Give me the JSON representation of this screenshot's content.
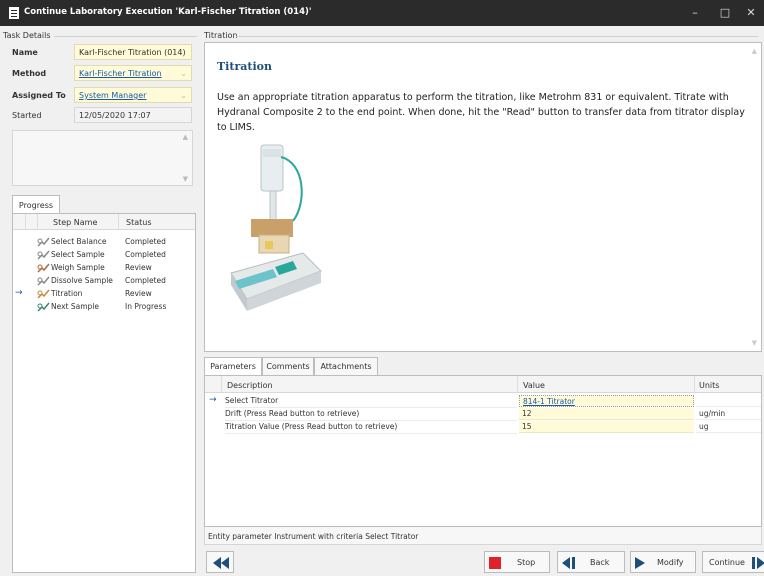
{
  "window": {
    "title": "Continue Laboratory Execution 'Karl-Fischer Titration (014)'"
  },
  "task_details": {
    "group_title": "Task Details",
    "name_label": "Name",
    "name_value": "Karl-Fischer Titration (014)",
    "method_label": "Method",
    "method_value": "Karl-Fischer Titration",
    "assigned_label": "Assigned To",
    "assigned_value": "System Manager",
    "started_label": "Started",
    "started_value": "12/05/2020 17:07"
  },
  "progress": {
    "tab": "Progress",
    "col_step": "Step Name",
    "col_status": "Status",
    "rows": [
      {
        "step": "Select Balance",
        "status": "Completed",
        "current": false,
        "icon": "done-steps-icon"
      },
      {
        "step": "Select Sample",
        "status": "Completed",
        "current": false,
        "icon": "done-steps-icon"
      },
      {
        "step": "Weigh Sample",
        "status": "Review",
        "current": false,
        "icon": "review-steps-icon"
      },
      {
        "step": "Dissolve Sample",
        "status": "Completed",
        "current": false,
        "icon": "done-steps-icon"
      },
      {
        "step": "Titration",
        "status": "Review",
        "current": true,
        "icon": "active-steps-icon"
      },
      {
        "step": "Next Sample",
        "status": "In Progress",
        "current": false,
        "icon": "progress-steps-icon"
      }
    ]
  },
  "titration": {
    "group_title": "Titration",
    "heading": "Titration",
    "instructions": "Use an appropriate titration apparatus to perform the titration, like Metrohm 831 or equivalent. Titrate with Hydranal Composite 2 to the end point. When done, hit the \"Read\" button to transfer data from titrator display to LIMS."
  },
  "params": {
    "tabs": [
      "Parameters",
      "Comments",
      "Attachments"
    ],
    "col_description": "Description",
    "col_value": "Value",
    "col_units": "Units",
    "rows": [
      {
        "description": "Select Titrator",
        "value": "814-1 Titrator",
        "units": "",
        "current": true
      },
      {
        "description": "Drift (Press Read button to retrieve)",
        "value": "12",
        "units": "ug/min",
        "current": false
      },
      {
        "description": "Titration Value (Press Read button to retrieve)",
        "value": "15",
        "units": "ug",
        "current": false
      }
    ],
    "status_text": "Entity parameter Instrument with criteria Select Titrator"
  },
  "buttons": {
    "stop": "Stop",
    "back": "Back",
    "modify": "Modify",
    "continue": "Continue"
  },
  "colors": {
    "titlebar": "#2b2b2b",
    "field_yellow": "#fffbd8",
    "link": "#1a5aa8",
    "stop_red": "#e0202a",
    "accent_blue": "#1f4e79"
  }
}
